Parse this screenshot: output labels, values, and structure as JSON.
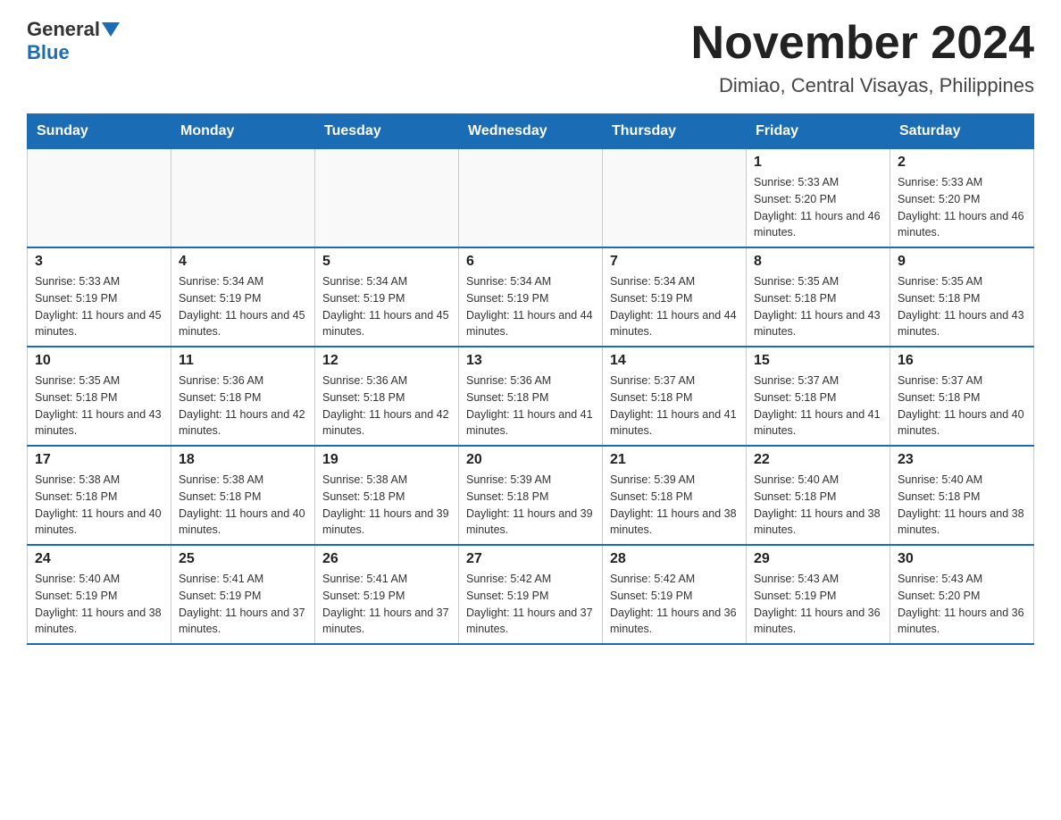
{
  "header": {
    "logo_general": "General",
    "logo_blue": "Blue",
    "title": "November 2024",
    "subtitle": "Dimiao, Central Visayas, Philippines"
  },
  "days_of_week": [
    "Sunday",
    "Monday",
    "Tuesday",
    "Wednesday",
    "Thursday",
    "Friday",
    "Saturday"
  ],
  "weeks": [
    [
      {
        "day": "",
        "info": ""
      },
      {
        "day": "",
        "info": ""
      },
      {
        "day": "",
        "info": ""
      },
      {
        "day": "",
        "info": ""
      },
      {
        "day": "",
        "info": ""
      },
      {
        "day": "1",
        "info": "Sunrise: 5:33 AM\nSunset: 5:20 PM\nDaylight: 11 hours and 46 minutes."
      },
      {
        "day": "2",
        "info": "Sunrise: 5:33 AM\nSunset: 5:20 PM\nDaylight: 11 hours and 46 minutes."
      }
    ],
    [
      {
        "day": "3",
        "info": "Sunrise: 5:33 AM\nSunset: 5:19 PM\nDaylight: 11 hours and 45 minutes."
      },
      {
        "day": "4",
        "info": "Sunrise: 5:34 AM\nSunset: 5:19 PM\nDaylight: 11 hours and 45 minutes."
      },
      {
        "day": "5",
        "info": "Sunrise: 5:34 AM\nSunset: 5:19 PM\nDaylight: 11 hours and 45 minutes."
      },
      {
        "day": "6",
        "info": "Sunrise: 5:34 AM\nSunset: 5:19 PM\nDaylight: 11 hours and 44 minutes."
      },
      {
        "day": "7",
        "info": "Sunrise: 5:34 AM\nSunset: 5:19 PM\nDaylight: 11 hours and 44 minutes."
      },
      {
        "day": "8",
        "info": "Sunrise: 5:35 AM\nSunset: 5:18 PM\nDaylight: 11 hours and 43 minutes."
      },
      {
        "day": "9",
        "info": "Sunrise: 5:35 AM\nSunset: 5:18 PM\nDaylight: 11 hours and 43 minutes."
      }
    ],
    [
      {
        "day": "10",
        "info": "Sunrise: 5:35 AM\nSunset: 5:18 PM\nDaylight: 11 hours and 43 minutes."
      },
      {
        "day": "11",
        "info": "Sunrise: 5:36 AM\nSunset: 5:18 PM\nDaylight: 11 hours and 42 minutes."
      },
      {
        "day": "12",
        "info": "Sunrise: 5:36 AM\nSunset: 5:18 PM\nDaylight: 11 hours and 42 minutes."
      },
      {
        "day": "13",
        "info": "Sunrise: 5:36 AM\nSunset: 5:18 PM\nDaylight: 11 hours and 41 minutes."
      },
      {
        "day": "14",
        "info": "Sunrise: 5:37 AM\nSunset: 5:18 PM\nDaylight: 11 hours and 41 minutes."
      },
      {
        "day": "15",
        "info": "Sunrise: 5:37 AM\nSunset: 5:18 PM\nDaylight: 11 hours and 41 minutes."
      },
      {
        "day": "16",
        "info": "Sunrise: 5:37 AM\nSunset: 5:18 PM\nDaylight: 11 hours and 40 minutes."
      }
    ],
    [
      {
        "day": "17",
        "info": "Sunrise: 5:38 AM\nSunset: 5:18 PM\nDaylight: 11 hours and 40 minutes."
      },
      {
        "day": "18",
        "info": "Sunrise: 5:38 AM\nSunset: 5:18 PM\nDaylight: 11 hours and 40 minutes."
      },
      {
        "day": "19",
        "info": "Sunrise: 5:38 AM\nSunset: 5:18 PM\nDaylight: 11 hours and 39 minutes."
      },
      {
        "day": "20",
        "info": "Sunrise: 5:39 AM\nSunset: 5:18 PM\nDaylight: 11 hours and 39 minutes."
      },
      {
        "day": "21",
        "info": "Sunrise: 5:39 AM\nSunset: 5:18 PM\nDaylight: 11 hours and 38 minutes."
      },
      {
        "day": "22",
        "info": "Sunrise: 5:40 AM\nSunset: 5:18 PM\nDaylight: 11 hours and 38 minutes."
      },
      {
        "day": "23",
        "info": "Sunrise: 5:40 AM\nSunset: 5:18 PM\nDaylight: 11 hours and 38 minutes."
      }
    ],
    [
      {
        "day": "24",
        "info": "Sunrise: 5:40 AM\nSunset: 5:19 PM\nDaylight: 11 hours and 38 minutes."
      },
      {
        "day": "25",
        "info": "Sunrise: 5:41 AM\nSunset: 5:19 PM\nDaylight: 11 hours and 37 minutes."
      },
      {
        "day": "26",
        "info": "Sunrise: 5:41 AM\nSunset: 5:19 PM\nDaylight: 11 hours and 37 minutes."
      },
      {
        "day": "27",
        "info": "Sunrise: 5:42 AM\nSunset: 5:19 PM\nDaylight: 11 hours and 37 minutes."
      },
      {
        "day": "28",
        "info": "Sunrise: 5:42 AM\nSunset: 5:19 PM\nDaylight: 11 hours and 36 minutes."
      },
      {
        "day": "29",
        "info": "Sunrise: 5:43 AM\nSunset: 5:19 PM\nDaylight: 11 hours and 36 minutes."
      },
      {
        "day": "30",
        "info": "Sunrise: 5:43 AM\nSunset: 5:20 PM\nDaylight: 11 hours and 36 minutes."
      }
    ]
  ]
}
